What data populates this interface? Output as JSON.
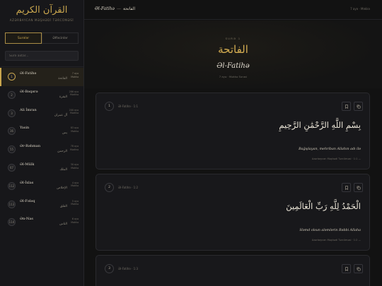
{
  "sidebar": {
    "brand_ar": "القرآن الكريم",
    "brand_sub": "AZƏRBAYCAN MƏŞHƏDİ TƏRCÜMƏSİ",
    "tabs": [
      "Surələr",
      "Əlfəcinlər"
    ],
    "active_tab": 0,
    "search_placeholder": "Surə axtar...",
    "surahs": [
      {
        "num": "1",
        "name": "Əl-Fatihə",
        "ar": "الفاتحة",
        "ayahs": "7 ayə",
        "place": "Məkkə",
        "active": true
      },
      {
        "num": "2",
        "name": "Əl-Bəqərə",
        "ar": "البقرة",
        "ayahs": "286 ayə",
        "place": "Mədinə",
        "active": false
      },
      {
        "num": "3",
        "name": "Ali İmran",
        "ar": "آل عمران",
        "ayahs": "200 ayə",
        "place": "Mədinə",
        "active": false
      },
      {
        "num": "36",
        "name": "Yasin",
        "ar": "يس",
        "ayahs": "83 ayə",
        "place": "Məkkə",
        "active": false
      },
      {
        "num": "55",
        "name": "Ər-Rəhman",
        "ar": "الرحمن",
        "ayahs": "78 ayə",
        "place": "Mədinə",
        "active": false
      },
      {
        "num": "67",
        "name": "Əl-Mülk",
        "ar": "الملك",
        "ayahs": "30 ayə",
        "place": "Məkkə",
        "active": false
      },
      {
        "num": "112",
        "name": "Əl-İxlas",
        "ar": "الإخلاص",
        "ayahs": "4 ayə",
        "place": "Məkkə",
        "active": false
      },
      {
        "num": "113",
        "name": "Əl-Fələq",
        "ar": "الفلق",
        "ayahs": "5 ayə",
        "place": "Məkkə",
        "active": false
      },
      {
        "num": "114",
        "name": "Ən-Nas",
        "ar": "الناس",
        "ayahs": "6 ayə",
        "place": "Məkkə",
        "active": false
      }
    ]
  },
  "topbar": {
    "title": "Əl-Fatihə",
    "sep": "—",
    "title_ar": "الفاتحة",
    "meta": "7 ayə · Məkkə"
  },
  "hero": {
    "label": "SURƏ 1",
    "ar": "الفاتحة",
    "name": "Əl-Fatihə",
    "meta": "7 ayə · Məkkə Surəsi"
  },
  "ayahs": [
    {
      "num": "1",
      "ref": "Əl-Fatihə · 1:1",
      "ar": "بِسْمِ اللَّهِ الرَّحْمَٰنِ الرَّحِيمِ",
      "tr": "Bağışlayan, mehriban Allahın adı ilə",
      "src": "Azərbaycan Məşhədi Tərcüməsi · 1:1 —"
    },
    {
      "num": "2",
      "ref": "Əl-Fatihə · 1:2",
      "ar": "الْحَمْدُ لِلَّهِ رَبِّ الْعَالَمِينَ",
      "tr": "Həmd olsun aləmlərin Rəbbi Allaha",
      "src": "Azərbaycan Məşhədi Tərcüməsi · 1:2 —"
    },
    {
      "num": "3",
      "ref": "Əl-Fatihə · 1:3",
      "ar": "",
      "tr": "",
      "src": ""
    }
  ],
  "icons": {
    "bookmark": "bookmark-icon",
    "copy": "copy-icon"
  },
  "colors": {
    "accent": "#c9a64e",
    "background": "#121212",
    "sidebar": "#17171a",
    "card": "#18181b"
  }
}
